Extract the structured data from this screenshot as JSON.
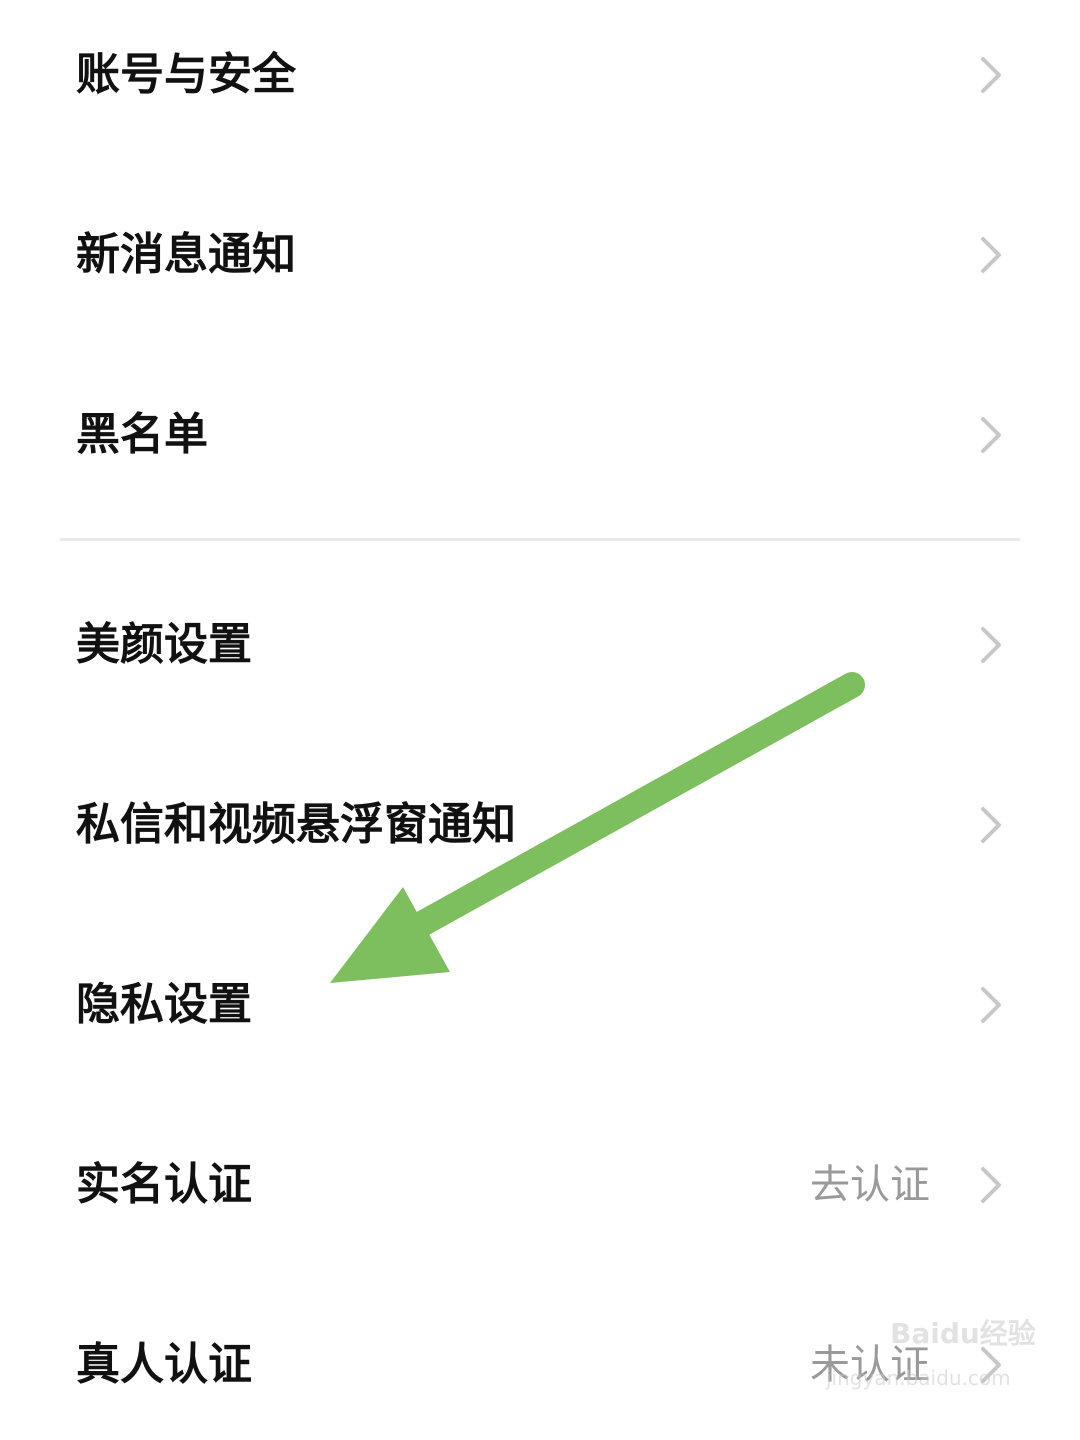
{
  "settings": {
    "items": [
      {
        "label": "账号与安全",
        "value": ""
      },
      {
        "label": "新消息通知",
        "value": ""
      },
      {
        "label": "黑名单",
        "value": ""
      },
      {
        "label": "美颜设置",
        "value": ""
      },
      {
        "label": "私信和视频悬浮窗通知",
        "value": ""
      },
      {
        "label": "隐私设置",
        "value": ""
      },
      {
        "label": "实名认证",
        "value": "去认证"
      },
      {
        "label": "真人认证",
        "value": "未认证"
      }
    ]
  },
  "annotation": {
    "arrow_color": "#7dbf5f",
    "points_to": "隐私设置"
  },
  "watermark": {
    "brand": "Baidu经验",
    "url": "jingyan.baidu.com"
  },
  "colors": {
    "label": "#111111",
    "secondary": "#9a9a9a",
    "chevron": "#c8c8c8",
    "divider": "#e9e9e9"
  }
}
